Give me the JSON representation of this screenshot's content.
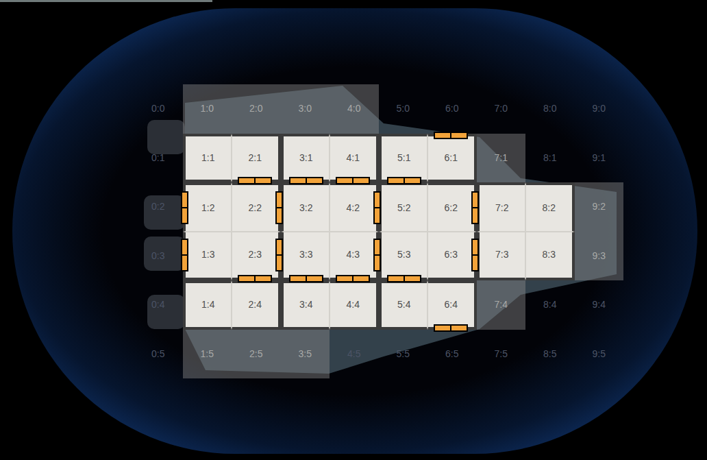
{
  "grid": {
    "cells": [
      {
        "label": "0:0",
        "kind": "space"
      },
      {
        "label": "1:0",
        "kind": "hull"
      },
      {
        "label": "2:0",
        "kind": "hull"
      },
      {
        "label": "3:0",
        "kind": "hull"
      },
      {
        "label": "4:0",
        "kind": "hull"
      },
      {
        "label": "5:0",
        "kind": "space"
      },
      {
        "label": "6:0",
        "kind": "space"
      },
      {
        "label": "7:0",
        "kind": "space"
      },
      {
        "label": "8:0",
        "kind": "space"
      },
      {
        "label": "9:0",
        "kind": "space"
      },
      {
        "label": "0:1",
        "kind": "space"
      },
      {
        "label": "1:1",
        "kind": "room"
      },
      {
        "label": "2:1",
        "kind": "room"
      },
      {
        "label": "3:1",
        "kind": "room"
      },
      {
        "label": "4:1",
        "kind": "room"
      },
      {
        "label": "5:1",
        "kind": "room"
      },
      {
        "label": "6:1",
        "kind": "room"
      },
      {
        "label": "7:1",
        "kind": "hull"
      },
      {
        "label": "8:1",
        "kind": "space"
      },
      {
        "label": "9:1",
        "kind": "space"
      },
      {
        "label": "0:2",
        "kind": "space"
      },
      {
        "label": "1:2",
        "kind": "room"
      },
      {
        "label": "2:2",
        "kind": "room"
      },
      {
        "label": "3:2",
        "kind": "room"
      },
      {
        "label": "4:2",
        "kind": "room"
      },
      {
        "label": "5:2",
        "kind": "room"
      },
      {
        "label": "6:2",
        "kind": "room"
      },
      {
        "label": "7:2",
        "kind": "room"
      },
      {
        "label": "8:2",
        "kind": "room"
      },
      {
        "label": "9:2",
        "kind": "hull"
      },
      {
        "label": "0:3",
        "kind": "space"
      },
      {
        "label": "1:3",
        "kind": "room"
      },
      {
        "label": "2:3",
        "kind": "room"
      },
      {
        "label": "3:3",
        "kind": "room"
      },
      {
        "label": "4:3",
        "kind": "room"
      },
      {
        "label": "5:3",
        "kind": "room"
      },
      {
        "label": "6:3",
        "kind": "room"
      },
      {
        "label": "7:3",
        "kind": "room"
      },
      {
        "label": "8:3",
        "kind": "room"
      },
      {
        "label": "9:3",
        "kind": "hull"
      },
      {
        "label": "0:4",
        "kind": "space"
      },
      {
        "label": "1:4",
        "kind": "room"
      },
      {
        "label": "2:4",
        "kind": "room"
      },
      {
        "label": "3:4",
        "kind": "room"
      },
      {
        "label": "4:4",
        "kind": "room"
      },
      {
        "label": "5:4",
        "kind": "room"
      },
      {
        "label": "6:4",
        "kind": "room"
      },
      {
        "label": "7:4",
        "kind": "hull"
      },
      {
        "label": "8:4",
        "kind": "space"
      },
      {
        "label": "9:4",
        "kind": "space"
      },
      {
        "label": "0:5",
        "kind": "space"
      },
      {
        "label": "1:5",
        "kind": "hull"
      },
      {
        "label": "2:5",
        "kind": "hull"
      },
      {
        "label": "3:5",
        "kind": "hull"
      },
      {
        "label": "4:5",
        "kind": "space"
      },
      {
        "label": "5:5",
        "kind": "space"
      },
      {
        "label": "6:5",
        "kind": "space"
      },
      {
        "label": "7:5",
        "kind": "space"
      },
      {
        "label": "8:5",
        "kind": "space"
      },
      {
        "label": "9:5",
        "kind": "space"
      }
    ]
  },
  "rooms": [
    {
      "cells": [
        "1:1",
        "2:1"
      ]
    },
    {
      "cells": [
        "3:1",
        "4:1"
      ]
    },
    {
      "cells": [
        "5:1",
        "6:1"
      ]
    },
    {
      "cells": [
        "1:2",
        "2:2",
        "1:3",
        "2:3"
      ]
    },
    {
      "cells": [
        "3:2",
        "4:2",
        "3:3",
        "4:3"
      ]
    },
    {
      "cells": [
        "5:2",
        "6:2",
        "5:3",
        "6:3"
      ]
    },
    {
      "cells": [
        "7:2",
        "8:2",
        "7:3",
        "8:3"
      ]
    },
    {
      "cells": [
        "1:4",
        "2:4"
      ]
    },
    {
      "cells": [
        "3:4",
        "4:4"
      ]
    },
    {
      "cells": [
        "5:4",
        "6:4"
      ]
    }
  ],
  "doors": [
    {
      "cell": "2:1",
      "side": "bottom"
    },
    {
      "cell": "3:1",
      "side": "bottom"
    },
    {
      "cell": "4:1",
      "side": "bottom"
    },
    {
      "cell": "5:1",
      "side": "bottom"
    },
    {
      "cell": "2:3",
      "side": "bottom"
    },
    {
      "cell": "3:3",
      "side": "bottom"
    },
    {
      "cell": "4:3",
      "side": "bottom"
    },
    {
      "cell": "5:3",
      "side": "bottom"
    },
    {
      "cell": "1:2",
      "side": "left"
    },
    {
      "cell": "1:3",
      "side": "left"
    },
    {
      "cell": "2:2",
      "side": "right"
    },
    {
      "cell": "2:3",
      "side": "right"
    },
    {
      "cell": "4:2",
      "side": "right"
    },
    {
      "cell": "4:3",
      "side": "right"
    },
    {
      "cell": "6:2",
      "side": "right"
    },
    {
      "cell": "6:3",
      "side": "right"
    },
    {
      "cell": "6:1",
      "side": "top"
    },
    {
      "cell": "6:4",
      "side": "bottom"
    }
  ]
}
